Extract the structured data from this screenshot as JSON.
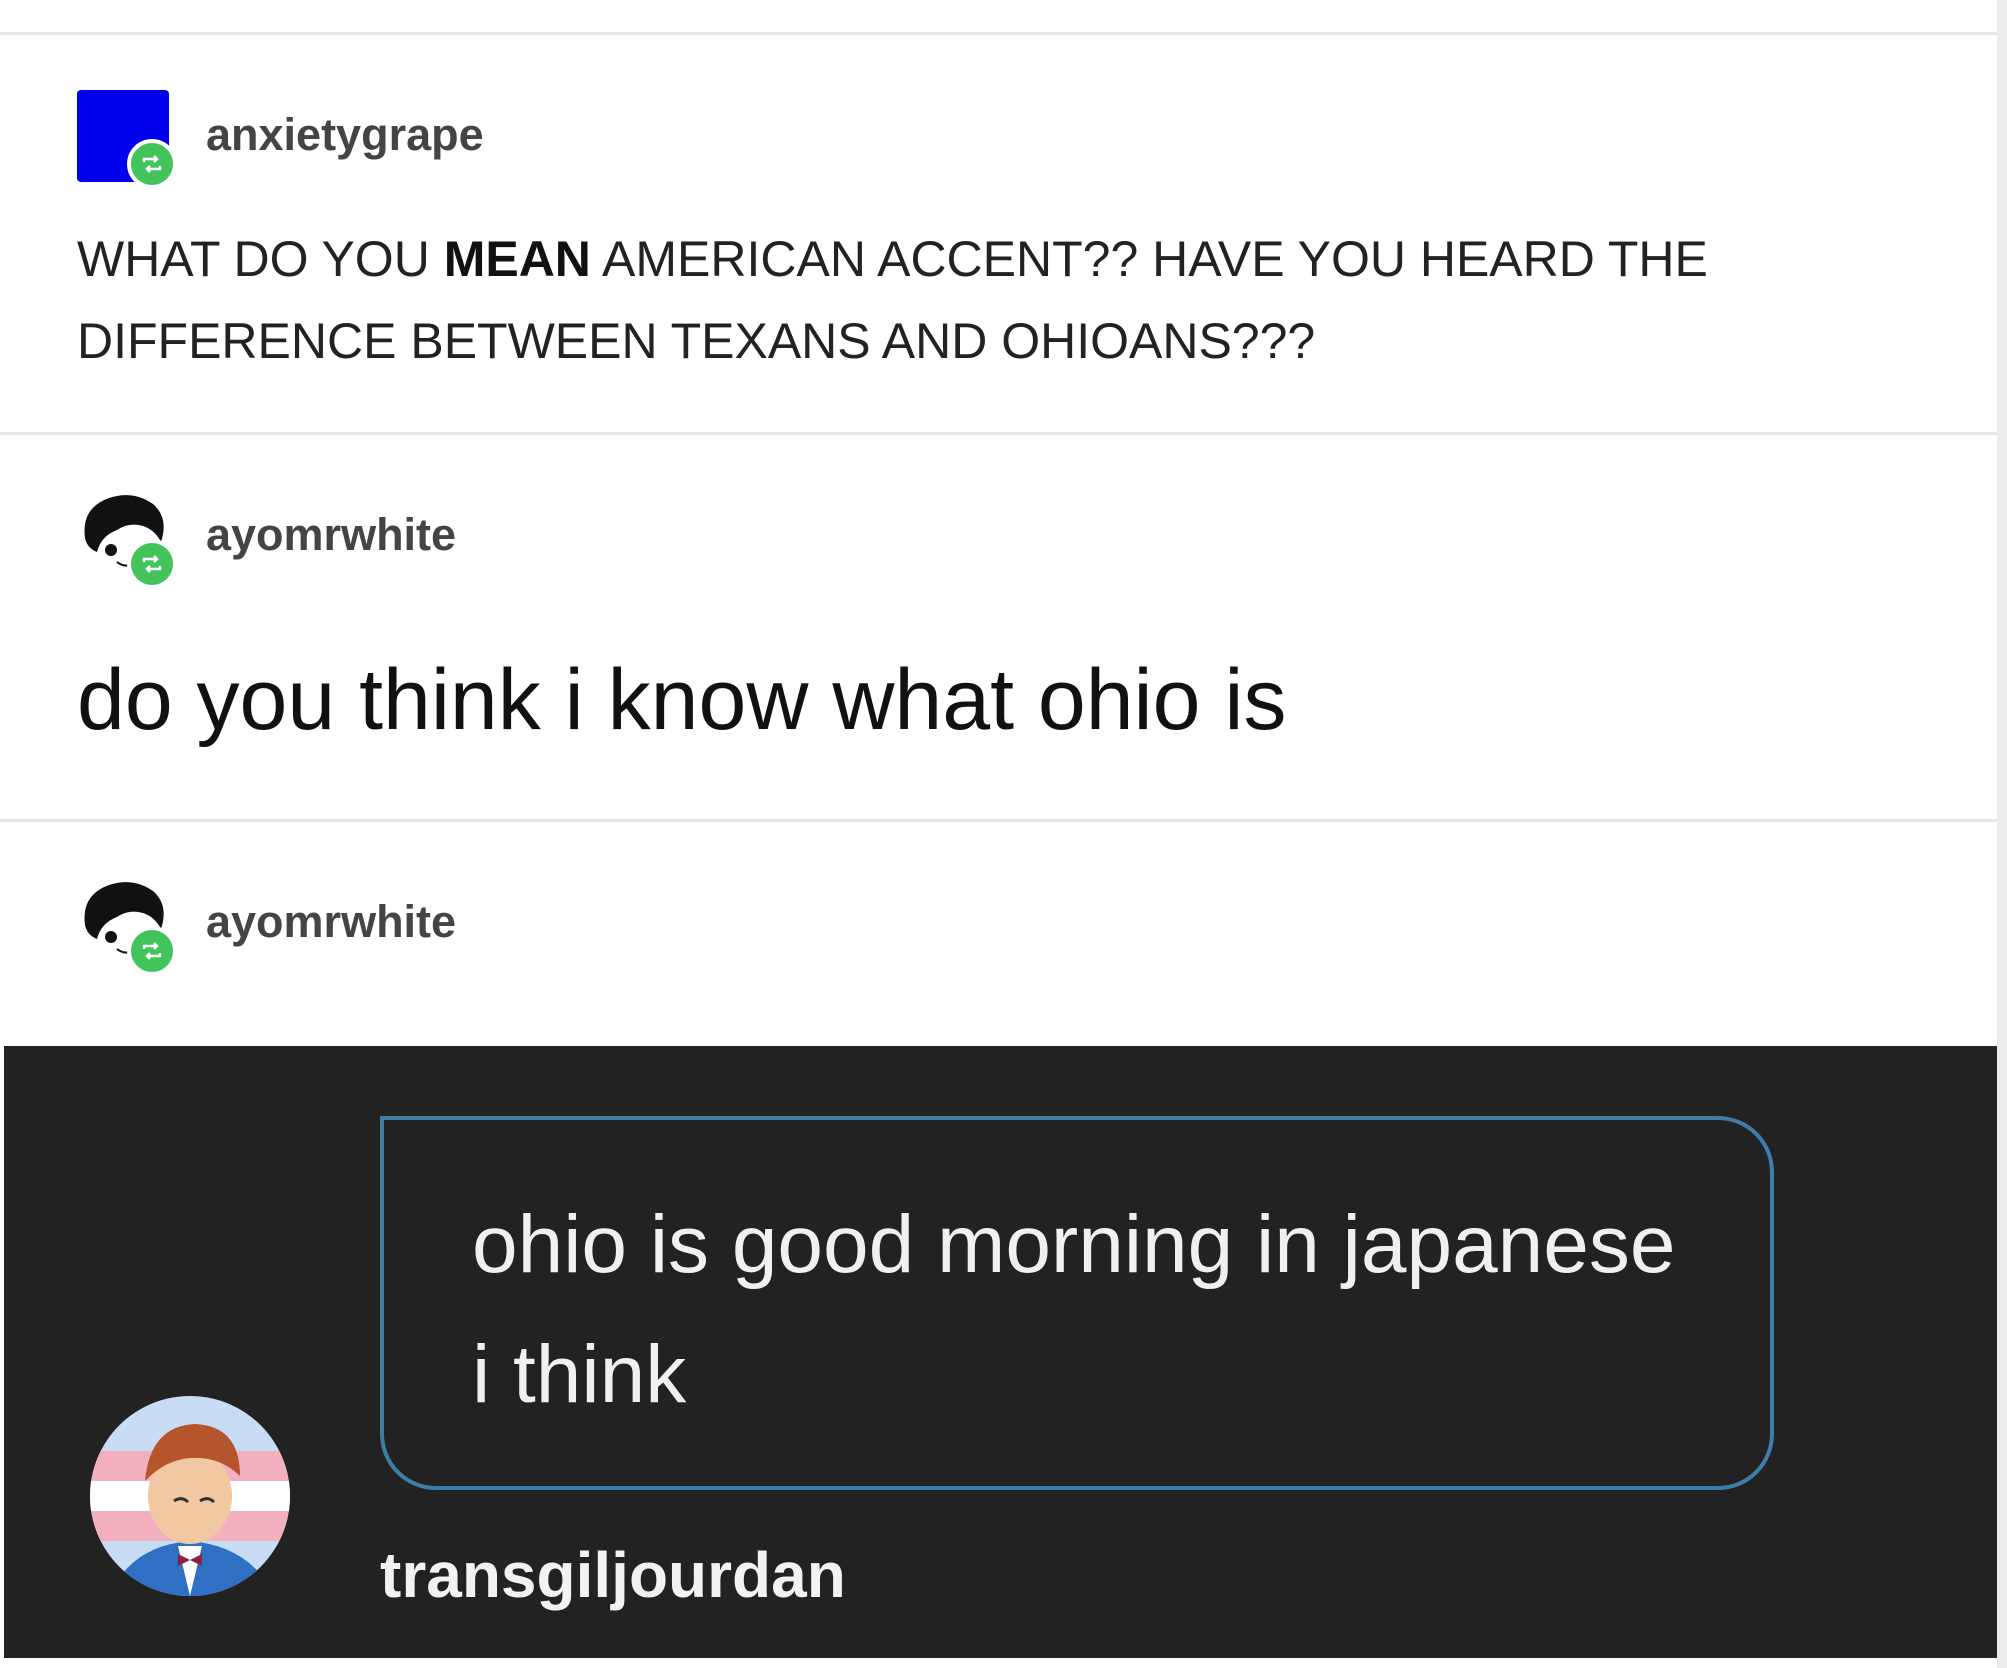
{
  "posts": [
    {
      "username": "anxietygrape",
      "text_before": "WHAT DO YOU ",
      "text_bold": "MEAN",
      "text_after": " AMERICAN ACCENT?? HAVE YOU HEARD THE DIFFERENCE BETWEEN TEXANS AND OHIOANS???"
    },
    {
      "username": "ayomrwhite",
      "text": "do you think i know what ohio is"
    },
    {
      "username": "ayomrwhite",
      "embedded_comment": {
        "text": "ohio is good morning in japanese i think",
        "username": "transgiljourdan"
      }
    }
  ],
  "colors": {
    "reblog_badge": "#43c45a",
    "avatar_blue": "#0000ee",
    "dark_panel": "#222223",
    "bubble_border": "#3e7ea6"
  },
  "icons": [
    "reblog-icon",
    "avatar-image"
  ]
}
